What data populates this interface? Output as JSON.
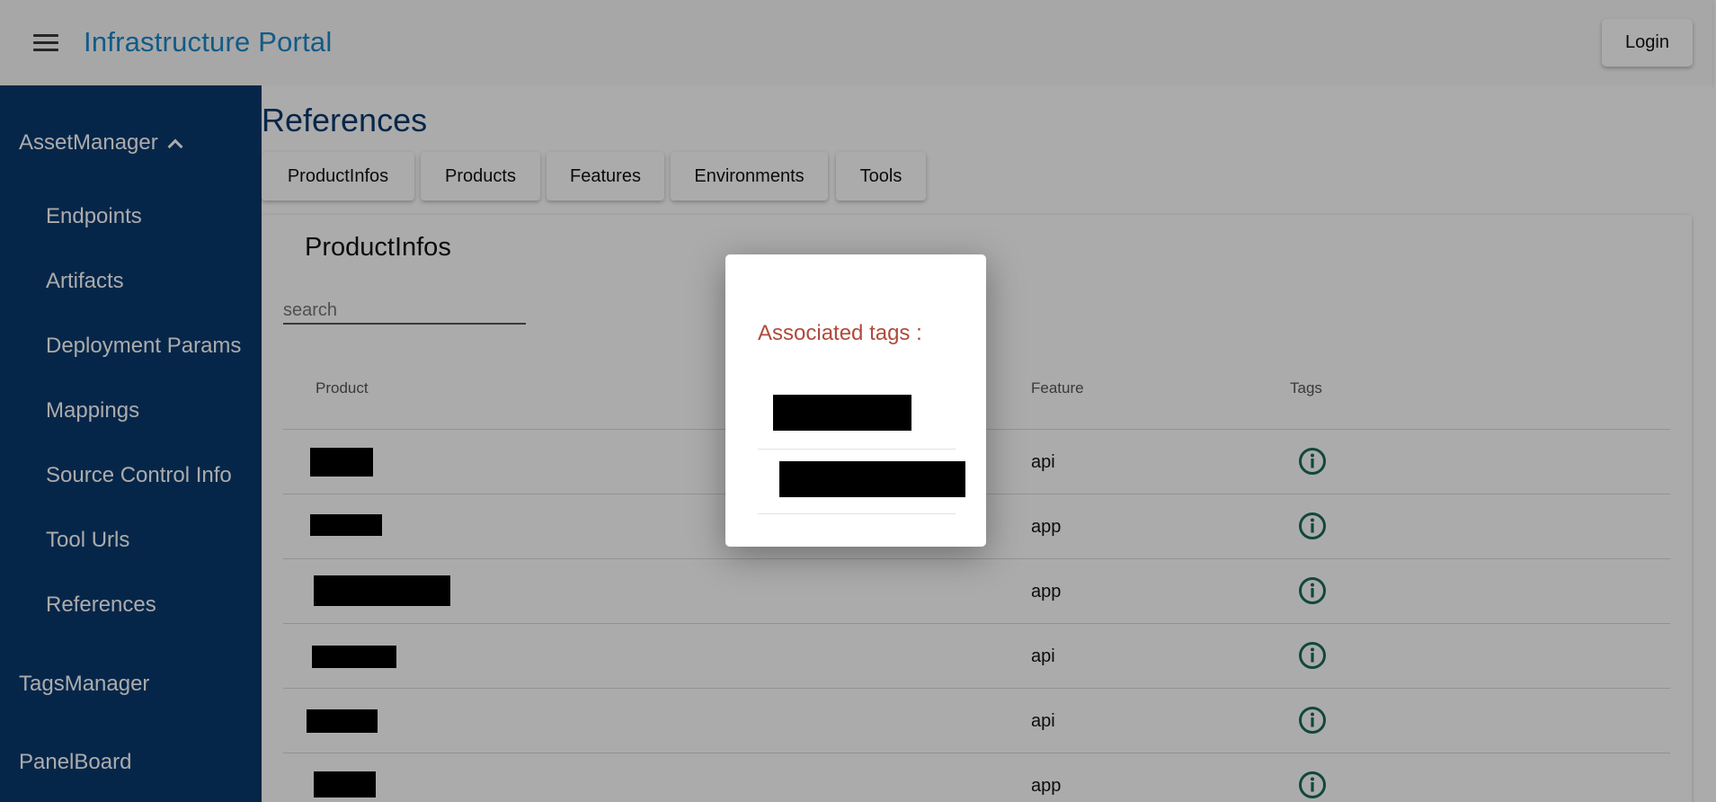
{
  "app": {
    "title": "Infrastructure Portal",
    "login_label": "Login"
  },
  "sidebar": {
    "groups": [
      {
        "label": "AssetManager",
        "expanded": true
      },
      {
        "label": "TagsManager"
      },
      {
        "label": "PanelBoard"
      }
    ],
    "items": [
      {
        "label": "Endpoints"
      },
      {
        "label": "Artifacts"
      },
      {
        "label": "Deployment Params"
      },
      {
        "label": "Mappings"
      },
      {
        "label": "Source Control Info"
      },
      {
        "label": "Tool Urls"
      },
      {
        "label": "References"
      }
    ]
  },
  "main": {
    "page_title": "References",
    "tabs": [
      {
        "label": "ProductInfos"
      },
      {
        "label": "Products"
      },
      {
        "label": "Features"
      },
      {
        "label": "Environments"
      },
      {
        "label": "Tools"
      }
    ],
    "card": {
      "title": "ProductInfos",
      "search_placeholder": "search",
      "columns": [
        "Product",
        "Feature",
        "Tags"
      ],
      "rows": [
        {
          "product": "[redacted]",
          "feature": "api"
        },
        {
          "product": "[redacted]",
          "feature": "app"
        },
        {
          "product": "[redacted]",
          "feature": "app"
        },
        {
          "product": "[redacted]",
          "feature": "api"
        },
        {
          "product": "[redacted]",
          "feature": "api"
        },
        {
          "product": "[redacted]",
          "feature": "app"
        }
      ]
    }
  },
  "dialog": {
    "title": "Associated tags :",
    "tags": [
      "[redacted]",
      "[redacted]"
    ]
  },
  "colors": {
    "appbar_bg": "#fafafa",
    "title_blue": "#1a88c9",
    "sidebar_bg": "#0a3a6e",
    "info_icon": "#1a6b5c",
    "dialog_title": "#b04a3c"
  },
  "icons": {
    "menu": "hamburger-menu-icon",
    "group_toggle": "chevron-up-icon",
    "tags": "info-circle-icon"
  }
}
